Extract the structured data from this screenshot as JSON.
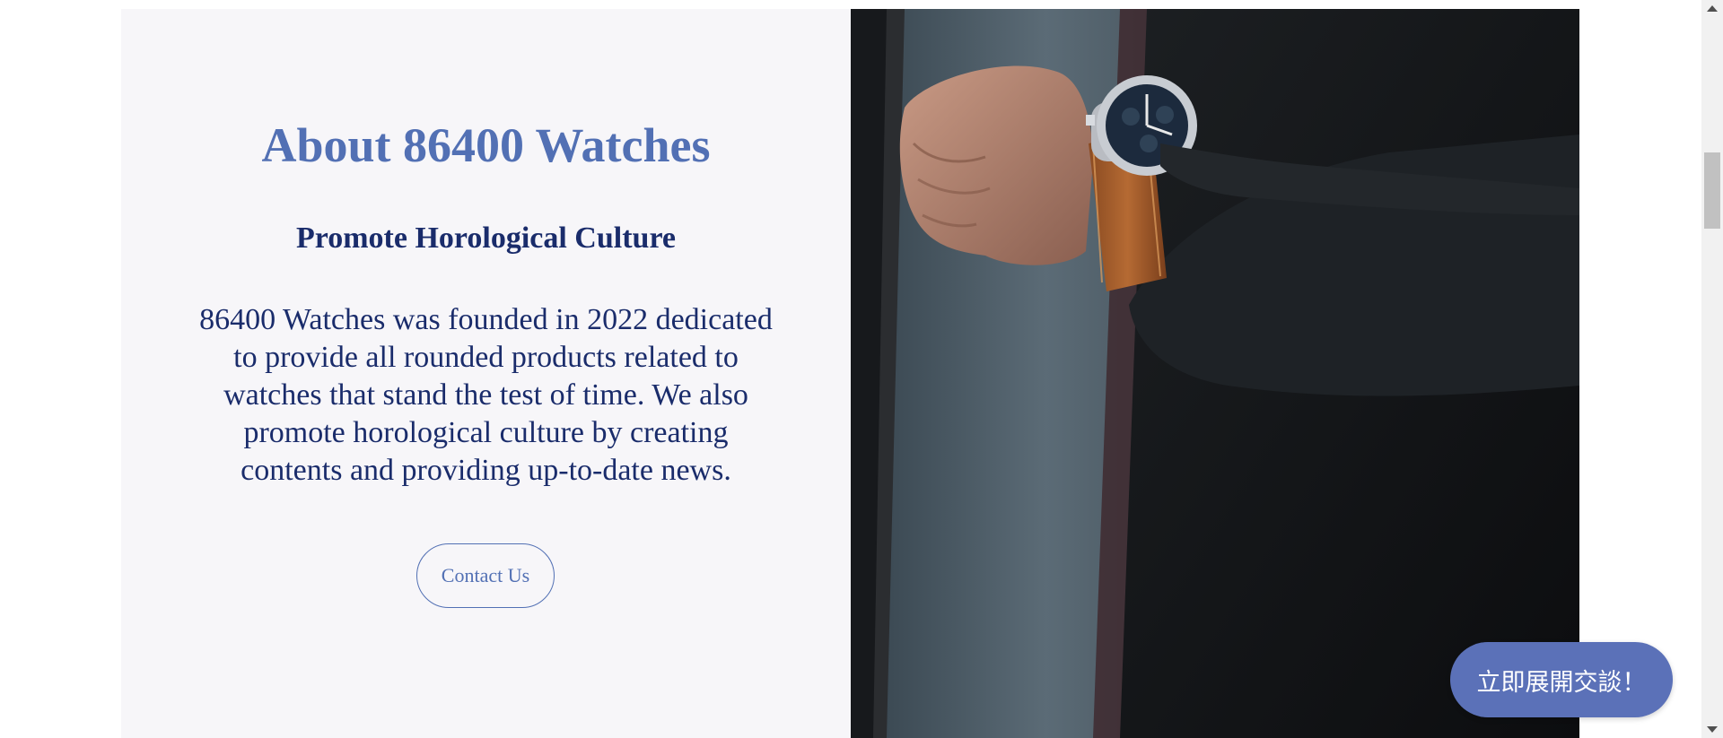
{
  "about": {
    "heading": "About 86400 Watches",
    "subheading": "Promote Horological Culture",
    "paragraph": "86400 Watches was founded in 2022 dedicated to provide all rounded products related to watches that stand the test of time. We also promote horological culture by creating contents and providing up-to-date news.",
    "contact_button": "Contact Us"
  },
  "chat": {
    "button_label": "立即展開交談！"
  },
  "image": {
    "subject": "man-wearing-wristwatch-photo"
  },
  "colors": {
    "accent": "#5270b4",
    "text_dark": "#1a2c6b",
    "panel_bg": "#f7f6f9",
    "chat_bg": "#5b71b8"
  }
}
